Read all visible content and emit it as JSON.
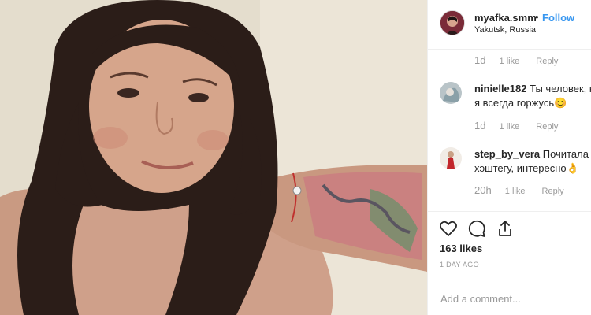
{
  "header": {
    "username": "myafka.smm",
    "dot": "•",
    "follow_label": "Follow",
    "location": "Yakutsk, Russia"
  },
  "comments": [
    {
      "username": "",
      "text": "",
      "time": "1d",
      "likes": "1 like",
      "reply": "Reply"
    },
    {
      "username": "ninielle182",
      "text": "Ты человек, ко",
      "text_line2": "я всегда горжусь😊",
      "time": "1d",
      "likes": "1 like",
      "reply": "Reply"
    },
    {
      "username": "step_by_vera",
      "text": "Почитала по",
      "text_line2": "хэштегу, интересно👌",
      "time": "20h",
      "likes": "1 like",
      "reply": "Reply"
    }
  ],
  "actions": {
    "like_icon": "heart-icon",
    "comment_icon": "comment-icon",
    "share_icon": "share-icon"
  },
  "likes_count": "163 likes",
  "post_date": "1 DAY AGO",
  "add_comment": {
    "placeholder": "Add a comment..."
  },
  "colors": {
    "accent": "#3897f0",
    "text": "#262626",
    "muted": "#999999"
  }
}
